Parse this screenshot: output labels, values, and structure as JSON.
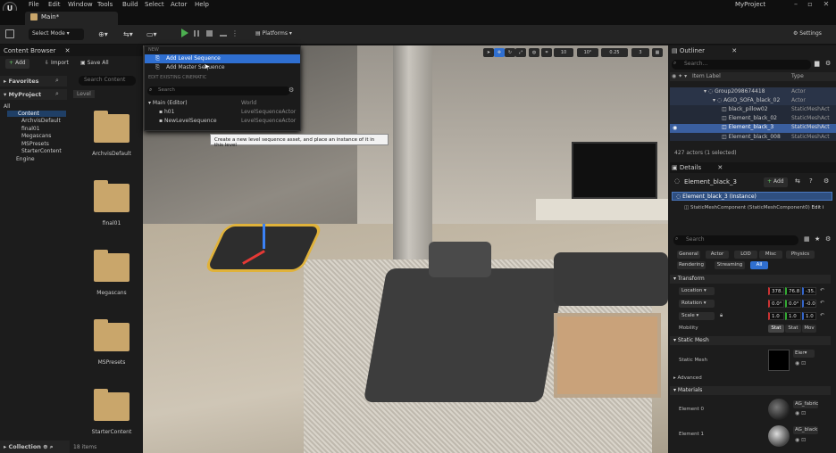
{
  "app": {
    "logo": "U",
    "project": "MyProject",
    "menu": [
      "File",
      "Edit",
      "Window",
      "Tools",
      "Build",
      "Select",
      "Actor",
      "Help"
    ],
    "tab": "Main*"
  },
  "toolbar": {
    "select_mode": "Select Mode",
    "platforms": "Platforms",
    "settings": "Settings"
  },
  "content_browser": {
    "title": "Content Browser",
    "add": "Add",
    "import": "Import",
    "save_all": "Save All",
    "favorites": "Favorites",
    "my_project": "MyProject",
    "search_placeholder": "Search Content",
    "breadcrumb": "Level",
    "tree": [
      "All",
      "Content",
      "ArchvisDefault",
      "final01",
      "Megascans",
      "MSPresets",
      "StarterContent",
      "Engine"
    ],
    "folders": [
      "ArchvisDefault",
      "final01",
      "Megascans",
      "MSPresets",
      "StarterContent"
    ],
    "collections": "Collection",
    "count": "18 items"
  },
  "dropdown": {
    "section1": "NEW",
    "item1": "Add Level Sequence",
    "item2": "Add Master Sequence",
    "section2": "EDIT EXISTING CINEMATIC",
    "search_placeholder": "Search",
    "rows": [
      {
        "name": "Main (Editor)",
        "type": "World"
      },
      {
        "name": "h01",
        "type": "LevelSequenceActor"
      },
      {
        "name": "NewLevelSequence",
        "type": "LevelSequenceActor"
      }
    ]
  },
  "tooltip": "Create a new level sequence asset, and place an instance of it in this level",
  "viewport": {
    "grid": "10",
    "angle": "10°",
    "scale": "0.25",
    "cams": "3"
  },
  "outliner": {
    "title": "Outliner",
    "search_placeholder": "Search...",
    "col_label": "Item Label",
    "col_type": "Type",
    "rows": [
      {
        "label": "Group2098674418",
        "type": "Actor"
      },
      {
        "label": "AGIO_SOFA_black_02",
        "type": "Actor"
      },
      {
        "label": "black_pillow02",
        "type": "StaticMeshAct"
      },
      {
        "label": "Element_black_02",
        "type": "StaticMeshAct"
      },
      {
        "label": "Element_black_3",
        "type": "StaticMeshAct"
      },
      {
        "label": "Element_black_008",
        "type": "StaticMeshAct"
      }
    ],
    "status": "427 actors (1 selected)"
  },
  "details": {
    "title": "Details",
    "object": "Element_black_3",
    "add": "Add",
    "instance": "Element_black_3 (Instance)",
    "component": "StaticMeshComponent (StaticMeshComponent0)",
    "edit": "Edit i",
    "search_placeholder": "Search",
    "tabs1": [
      "General",
      "Actor",
      "LOD",
      "Misc",
      "Physics"
    ],
    "tabs2": [
      "Rendering",
      "Streaming",
      "All"
    ],
    "transform": "Transform",
    "location": "Location",
    "rotation": "Rotation",
    "scale": "Scale",
    "mobility": "Mobility",
    "loc": [
      "378.",
      "76.8",
      "-35."
    ],
    "rot": [
      "0.0°",
      "0.0°",
      "-0.0"
    ],
    "scl": [
      "1.0",
      "1.0",
      "1.0"
    ],
    "mob": [
      "Stat",
      "Stat",
      "Mov"
    ],
    "static_mesh_hdr": "Static Mesh",
    "static_mesh": "Static Mesh",
    "mesh_val": "Eler",
    "advanced": "Advanced",
    "materials": "Materials",
    "el0": "Element 0",
    "el1": "Element 1",
    "mat0": "AG_fabric",
    "mat1": "AG_black"
  }
}
